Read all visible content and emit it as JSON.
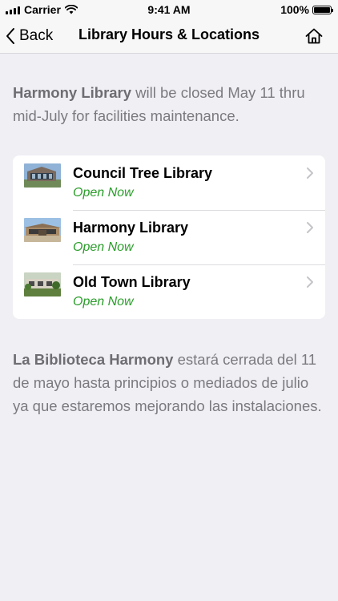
{
  "status_bar": {
    "carrier": "Carrier",
    "time": "9:41 AM",
    "battery": "100%",
    "battery_level": 1.0
  },
  "nav": {
    "back_label": "Back",
    "title": "Library Hours & Locations",
    "home_icon": "home-icon"
  },
  "notice_en": {
    "bold": "Harmony Library",
    "text": " will be closed May 11 thru mid-July for facilities maintenance."
  },
  "libraries": [
    {
      "name": "Council Tree Library",
      "status": "Open Now",
      "icon": "library-photo"
    },
    {
      "name": "Harmony Library",
      "status": "Open Now",
      "icon": "library-photo"
    },
    {
      "name": "Old Town Library",
      "status": "Open Now",
      "icon": "library-photo"
    }
  ],
  "notice_es": {
    "bold": "La Biblioteca Harmony",
    "text": " estará cerrada del 11 de mayo hasta principios o mediados de julio ya que estaremos mejorando las instalaciones."
  },
  "colors": {
    "open_status": "#2a9d2a",
    "background": "#efeff4",
    "notice_text": "#7a7a7f"
  }
}
